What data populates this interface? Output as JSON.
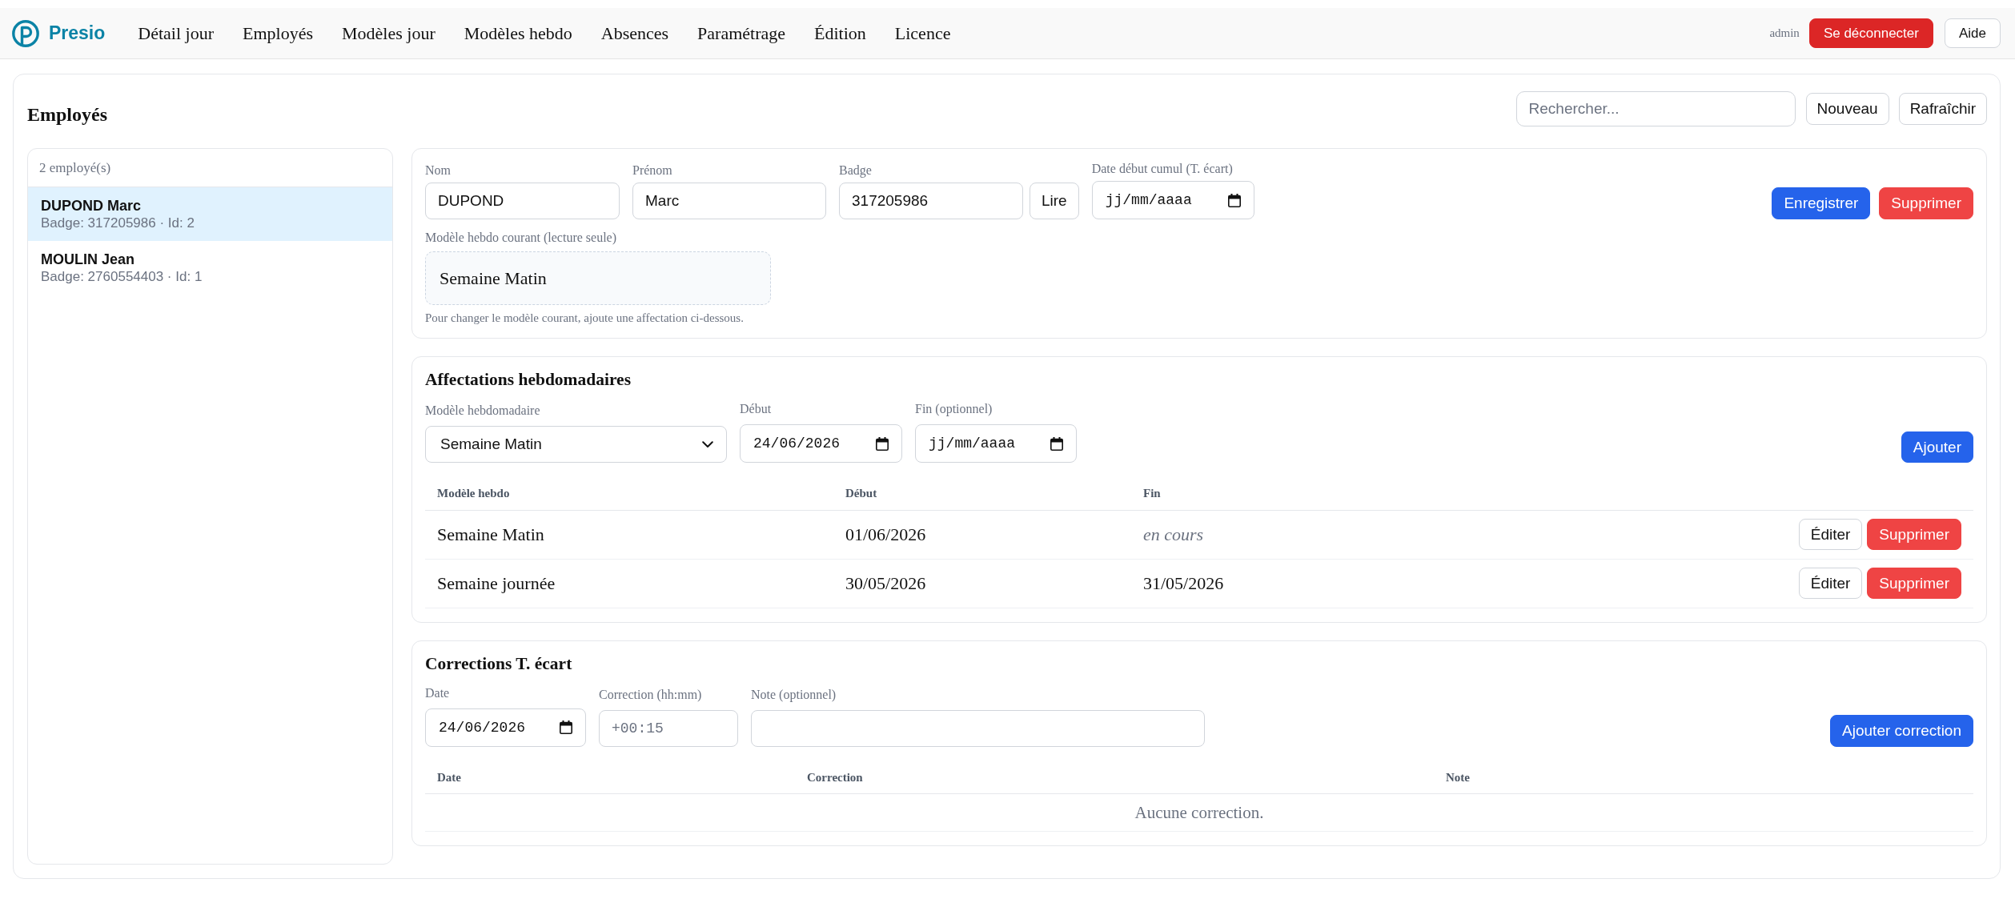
{
  "nav": {
    "brand": "Presio",
    "links": [
      "Détail jour",
      "Employés",
      "Modèles jour",
      "Modèles hebdo",
      "Absences",
      "Paramétrage",
      "Édition",
      "Licence"
    ],
    "user": "admin",
    "logout_button": "Se déconnecter",
    "help_button": "Aide"
  },
  "header": {
    "title": "Employés",
    "search": {
      "placeholder": "Rechercher..."
    },
    "buttons": [
      "Nouveau",
      "Rafraîchir"
    ]
  },
  "employee_list": {
    "count": "2 employé(s)",
    "items": [
      {
        "name": "DUPOND Marc",
        "details": "Badge: 317205986 · Id: 2",
        "selected": true
      },
      {
        "name": "MOULIN Jean",
        "details": "Badge: 2760554403 · Id: 1",
        "selected": false
      }
    ]
  },
  "employee_form": {
    "fields": [
      {
        "kind": "text",
        "label": "Nom",
        "value": "DUPOND"
      },
      {
        "kind": "text",
        "label": "Prénom",
        "value": "Marc"
      },
      {
        "kind": "text",
        "label": "Badge",
        "value": "317205986",
        "button": "Lire"
      },
      {
        "kind": "date",
        "label": "Date début cumul (T. écart)",
        "placeholder": "jj/mm/aaaa"
      }
    ],
    "buttons": [
      {
        "kind": "primary",
        "label": "Enregistrer"
      },
      {
        "kind": "danger",
        "label": "Supprimer"
      }
    ],
    "current_model": {
      "label": "Modèle hebdo courant (lecture seule)",
      "value": "Semaine Matin"
    },
    "hint": "Pour changer le modèle courant, ajoute une affectation ci-dessous."
  },
  "assignments": {
    "title": "Affectations hebdomadaires",
    "fields": [
      {
        "kind": "select",
        "label": "Modèle hebdomadaire",
        "value": "Semaine Matin"
      },
      {
        "kind": "date",
        "label": "Début",
        "value": "24/06/2026"
      },
      {
        "kind": "date",
        "label": "Fin (optionnel)",
        "placeholder": "jj/mm/aaaa"
      }
    ],
    "add_button": "Ajouter",
    "table": {
      "columns": [
        "Modèle hebdo",
        "Début",
        "Fin"
      ],
      "rows": [
        {
          "model": "Semaine Matin",
          "start": "01/06/2026",
          "end": "en cours",
          "open_ended": true,
          "actions": [
            {
              "kind": "outline",
              "label": "Éditer"
            },
            {
              "kind": "danger",
              "label": "Supprimer"
            }
          ]
        },
        {
          "model": "Semaine journée",
          "start": "30/05/2026",
          "end": "31/05/2026",
          "open_ended": false,
          "actions": [
            {
              "kind": "outline",
              "label": "Éditer"
            },
            {
              "kind": "danger",
              "label": "Supprimer"
            }
          ]
        }
      ]
    }
  },
  "corrections": {
    "title": "Corrections T. écart",
    "fields": [
      {
        "kind": "date",
        "label": "Date",
        "value": "24/06/2026"
      },
      {
        "kind": "time",
        "label": "Correction (hh:mm)",
        "placeholder": "+00:15"
      },
      {
        "kind": "text",
        "label": "Note (optionnel)"
      }
    ],
    "add_button": "Ajouter correction",
    "table": {
      "columns": [
        "Date",
        "Correction",
        "Note"
      ],
      "empty_message": "Aucune correction."
    }
  }
}
